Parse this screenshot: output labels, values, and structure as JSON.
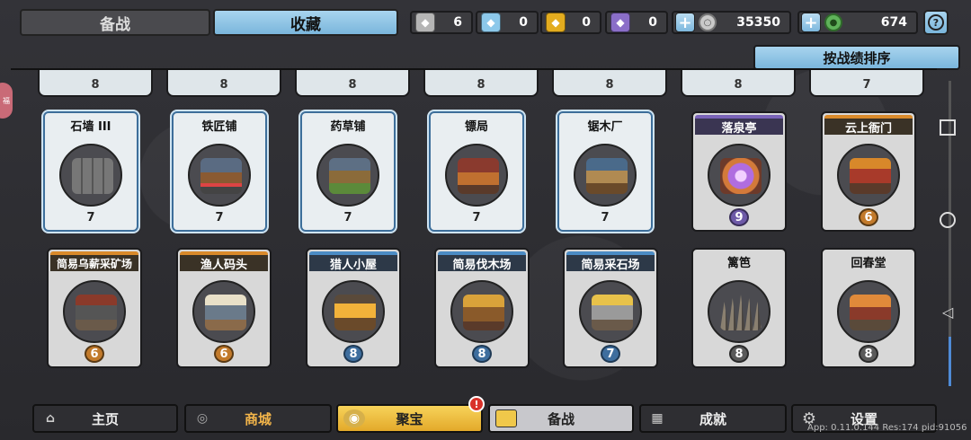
{
  "tabs": {
    "prep": "备战",
    "favorites": "收藏"
  },
  "resources": [
    {
      "icon": "silver-badge-icon",
      "value": "6",
      "color": "#b5b5b5"
    },
    {
      "icon": "blue-crystal-icon",
      "value": "0",
      "color": "#8cc8ea"
    },
    {
      "icon": "gold-shield-icon",
      "value": "0",
      "color": "#e3ac1f"
    },
    {
      "icon": "purple-mask-icon",
      "value": "0",
      "color": "#8a6ec8"
    }
  ],
  "currency": {
    "silver": {
      "icon": "silver-coin-icon",
      "value": "35350"
    },
    "jade": {
      "icon": "jade-coin-icon",
      "value": "674"
    }
  },
  "sort_label": "按战绩排序",
  "left_edge_glyph": "福",
  "top_row_levels": [
    "8",
    "8",
    "8",
    "8",
    "8",
    "8",
    "7"
  ],
  "row1": [
    {
      "name": "石墙 III",
      "level": "7",
      "style": "frost",
      "art": "a-wall"
    },
    {
      "name": "铁匠铺",
      "level": "7",
      "style": "frost",
      "art": "a-smith"
    },
    {
      "name": "药草铺",
      "level": "7",
      "style": "frost",
      "art": "a-herb"
    },
    {
      "name": "镖局",
      "level": "7",
      "style": "frost",
      "art": "a-escort"
    },
    {
      "name": "锯木厂",
      "level": "7",
      "style": "frost",
      "art": "a-saw"
    },
    {
      "name": "落泉亭",
      "level": "9",
      "style": "purple",
      "art": "a-spring"
    },
    {
      "name": "云上衙门",
      "level": "6",
      "style": "orange",
      "art": "a-cloud"
    }
  ],
  "row2": [
    {
      "name": "简易乌薪采矿场",
      "level": "6",
      "style": "orange",
      "art": "a-tung"
    },
    {
      "name": "渔人码头",
      "level": "6",
      "style": "orange",
      "art": "a-fish"
    },
    {
      "name": "猎人小屋",
      "level": "8",
      "style": "blue",
      "art": "a-hunt"
    },
    {
      "name": "简易伐木场",
      "level": "8",
      "style": "blue",
      "art": "a-lumber"
    },
    {
      "name": "简易采石场",
      "level": "7",
      "style": "blue",
      "art": "a-stone"
    },
    {
      "name": "篱笆",
      "level": "8",
      "style": "gray",
      "art": "a-fence"
    },
    {
      "name": "回春堂",
      "level": "8",
      "style": "gray",
      "art": "a-clinic"
    }
  ],
  "nav": [
    {
      "label": "主页",
      "icon": "home-icon"
    },
    {
      "label": "商城",
      "icon": "coins-icon"
    },
    {
      "label": "聚宝",
      "icon": "treasure-pot-icon"
    },
    {
      "label": "备战",
      "icon": "card-icon"
    },
    {
      "label": "成就",
      "icon": "achievement-icon"
    },
    {
      "label": "设置",
      "icon": "gear-icon"
    }
  ],
  "notification_badge": "!",
  "version": "App: 0.11.0.144 Res:174 pid:91056"
}
